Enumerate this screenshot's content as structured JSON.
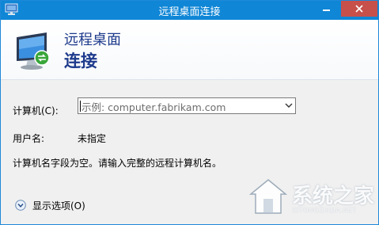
{
  "window": {
    "title": "远程桌面连接"
  },
  "header": {
    "line1": "远程桌面",
    "line2": "连接"
  },
  "form": {
    "computer_label": "计算机(C):",
    "computer_placeholder": "示例: computer.fabrikam.com",
    "username_label": "用户名:",
    "username_value": "未指定",
    "status_message": "计算机名字段为空。请输入完整的远程计算机名。"
  },
  "options": {
    "label": "显示选项(O)"
  },
  "watermark": {
    "text": "系统之家",
    "sub": "XITONGZHIJIA.NET"
  },
  "colors": {
    "titlebar": "#0f86d6",
    "close_button": "#c7504b",
    "header_text": "#1d3a8c"
  }
}
